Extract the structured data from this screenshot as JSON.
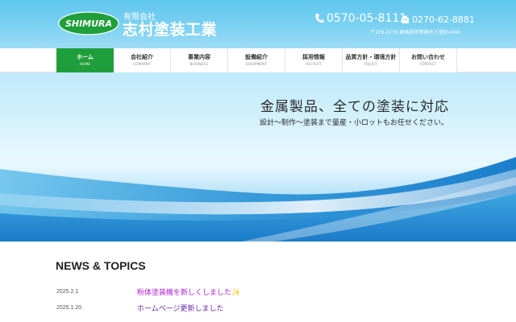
{
  "colors": {
    "header_bg": "#6ccdf0",
    "nav_active": "#1f9f3b",
    "news_title_1": "#b01fd1",
    "news_title_2": "#6a2aa8"
  },
  "header": {
    "logo_text": "SHIMURA",
    "company_type": "有限会社",
    "company_name": "志村塗装工業",
    "phone": "0570-05-8111",
    "fax": "0270-62-8881",
    "address": "〒379-2235 群馬県伊勢崎市三室町4040",
    "phone_icon": "phone-icon",
    "fax_icon": "fax-icon"
  },
  "nav": {
    "items": [
      {
        "label": "ホーム",
        "en": "HOME",
        "active": true
      },
      {
        "label": "会社紹介",
        "en": "COMPANY",
        "active": false
      },
      {
        "label": "事業内容",
        "en": "BUSINESS",
        "active": false
      },
      {
        "label": "設備紹介",
        "en": "EQUIPMENT",
        "active": false
      },
      {
        "label": "採用情報",
        "en": "RECRUIT",
        "active": false
      },
      {
        "label": "品質方針・環境方針",
        "en": "POLICY",
        "active": false
      },
      {
        "label": "お問い合わせ",
        "en": "CONTACT",
        "active": false
      }
    ]
  },
  "hero": {
    "title": "金属製品、全ての塗装に対応",
    "subtitle": "設計～制作～塗装まで量産・小ロットもお任せください。"
  },
  "news": {
    "heading": "NEWS & TOPICS",
    "items": [
      {
        "date": "2025.2.1",
        "title": "粉体塗装機を新しくしました✨"
      },
      {
        "date": "2025.1.20",
        "title": "ホームページ更新しました"
      }
    ]
  }
}
